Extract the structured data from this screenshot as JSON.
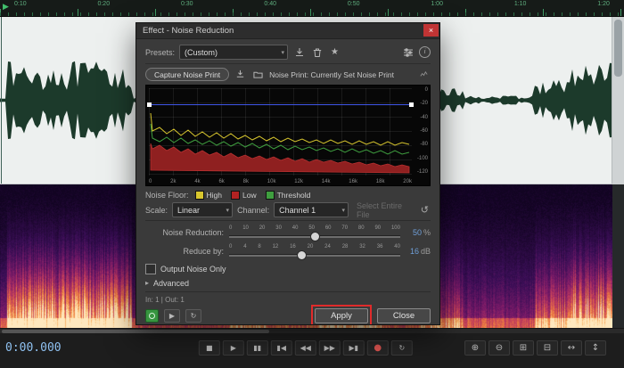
{
  "glyphs": {
    "play": "▶",
    "loop": "↻",
    "chevron": "▾",
    "star": "★",
    "reset": "↺",
    "advanced_arrow": "▸",
    "info": "i",
    "close": "×"
  },
  "editor": {
    "ruler_labels": [
      "0:10",
      "0:20",
      "0:30",
      "0:40",
      "0:50",
      "1:00",
      "1:10",
      "1:20"
    ],
    "time_display": "0:00.000"
  },
  "transport": {
    "buttons": [
      {
        "name": "stop",
        "glyph": "■"
      },
      {
        "name": "play",
        "glyph": "▶"
      },
      {
        "name": "pause",
        "glyph": "▮▮"
      },
      {
        "name": "skip-to-start",
        "glyph": "▮◀"
      },
      {
        "name": "rewind",
        "glyph": "◀◀"
      },
      {
        "name": "fast-forward",
        "glyph": "▶▶"
      },
      {
        "name": "skip-to-end",
        "glyph": "▶▮"
      },
      {
        "name": "record",
        "glyph": "●"
      },
      {
        "name": "loop",
        "glyph": "↻"
      }
    ],
    "zoom_buttons": [
      {
        "name": "zoom-in",
        "glyph": "⊕"
      },
      {
        "name": "zoom-out",
        "glyph": "⊖"
      },
      {
        "name": "zoom-in-time",
        "glyph": "⊞"
      },
      {
        "name": "zoom-out-time",
        "glyph": "⊟"
      },
      {
        "name": "zoom-horizontal",
        "glyph": "↔"
      },
      {
        "name": "zoom-vertical",
        "glyph": "↕"
      }
    ]
  },
  "dialog": {
    "title": "Effect - Noise Reduction",
    "presets": {
      "label": "Presets:",
      "value": "(Custom)"
    },
    "noise_print": {
      "capture_button": "Capture Noise Print",
      "status": "Noise Print: Currently Set Noise Print"
    },
    "graph": {
      "freq_ticks": [
        "0",
        "2k",
        "4k",
        "6k",
        "8k",
        "10k",
        "12k",
        "14k",
        "16k",
        "18k",
        "20k"
      ],
      "db_ticks": [
        "0",
        "-20",
        "-40",
        "-60",
        "-80",
        "-100",
        "-120"
      ]
    },
    "legend": {
      "label": "Noise Floor:",
      "items": [
        {
          "label": "High",
          "color": "#d8c62e"
        },
        {
          "label": "Low",
          "color": "#b22222"
        },
        {
          "label": "Threshold",
          "color": "#3f9e3f"
        }
      ]
    },
    "scale": {
      "label": "Scale:",
      "value": "Linear"
    },
    "channel": {
      "label": "Channel:",
      "value": "Channel 1"
    },
    "select_entire_file_label": "Select Entire File",
    "noise_reduction": {
      "label": "Noise Reduction:",
      "ticks": [
        "0",
        "10",
        "20",
        "30",
        "40",
        "50",
        "60",
        "70",
        "80",
        "90",
        "100"
      ],
      "value": "50",
      "unit": "%"
    },
    "reduce_by": {
      "label": "Reduce by:",
      "ticks": [
        "0",
        "4",
        "8",
        "12",
        "16",
        "20",
        "24",
        "28",
        "32",
        "36",
        "40"
      ],
      "value": "16",
      "unit": "dB"
    },
    "output_noise_only_label": "Output Noise Only",
    "advanced_label": "Advanced",
    "io_status": "In: 1 | Out: 1",
    "apply_label": "Apply",
    "close_label": "Close"
  },
  "colors": {
    "value_blue": "#6f9fd8",
    "annotation_red": "#e02b2b",
    "record_red": "#d9534f",
    "threshold_line_blue": "#4056e8"
  }
}
